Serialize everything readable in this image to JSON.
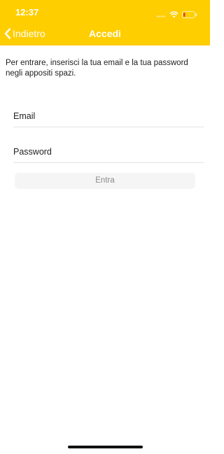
{
  "status_bar": {
    "time": "12:37",
    "icons": [
      "signal-dots-icon",
      "wifi-icon",
      "battery-low-icon"
    ],
    "battery_color": "#e53935"
  },
  "nav": {
    "back_label": "Indietro",
    "title": "Accedi"
  },
  "main": {
    "intro_text": "Per entrare, inserisci la tua email e la tua password negli appositi spazi.",
    "email_placeholder": "Email",
    "password_placeholder": "Password",
    "submit_label": "Entra"
  },
  "colors": {
    "accent": "#ffce00",
    "nav_text": "#ffffff",
    "button_bg": "#f5f5f5",
    "button_text": "#8a8a8a"
  }
}
